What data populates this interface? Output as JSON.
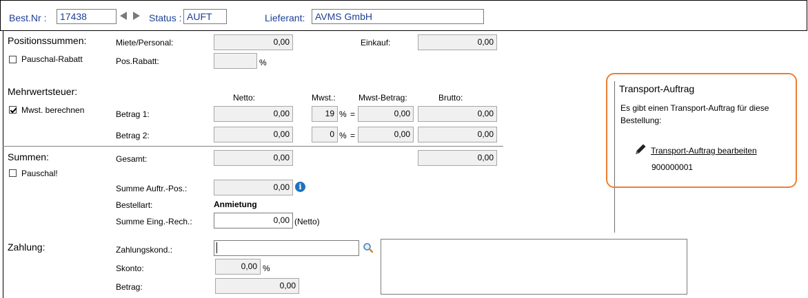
{
  "header": {
    "best_nr_label": "Best.Nr :",
    "best_nr_value": "17438",
    "status_label": "Status :",
    "status_value": "AUFT",
    "lieferant_label": "Lieferant:",
    "lieferant_value": "AVMS GmbH"
  },
  "positionssummen": {
    "title": "Positionssummen:",
    "pauschal_rabatt_label": "Pauschal-Rabatt",
    "pauschal_rabatt_checked": false,
    "miete_label": "Miete/Personal:",
    "miete_value": "0,00",
    "einkauf_label": "Einkauf:",
    "einkauf_value": "0,00",
    "posrabatt_label": "Pos.Rabatt:",
    "posrabatt_value": "",
    "percent": "%"
  },
  "mwst": {
    "title": "Mehrwertsteuer:",
    "berechnen_label": "Mwst. berechnen",
    "berechnen_checked": true,
    "col_netto": "Netto:",
    "col_mwst": "Mwst.:",
    "col_mwst_betrag": "Mwst-Betrag:",
    "col_brutto": "Brutto:",
    "percent": "%",
    "equals": "=",
    "rows": [
      {
        "label": "Betrag 1:",
        "netto": "0,00",
        "mwst": "19",
        "mwst_betrag": "0,00",
        "brutto": "0,00"
      },
      {
        "label": "Betrag 2:",
        "netto": "0,00",
        "mwst": "0",
        "mwst_betrag": "0,00",
        "brutto": "0,00"
      }
    ]
  },
  "summen": {
    "title": "Summen:",
    "pauschal_label": "Pauschal!",
    "pauschal_checked": false,
    "gesamt_label": "Gesamt:",
    "gesamt_netto": "0,00",
    "gesamt_brutto": "0,00",
    "summe_auftr_label": "Summe Auftr.-Pos.:",
    "summe_auftr_value": "0,00",
    "bestellart_label": "Bestellart:",
    "bestellart_value": "Anmietung",
    "summe_eing_label": "Summe Eing.-Rech.:",
    "summe_eing_value": "0,00",
    "netto_suffix": "(Netto)"
  },
  "zahlung": {
    "title": "Zahlung:",
    "kond_label": "Zahlungskond.:",
    "kond_value": "",
    "skonto_label": "Skonto:",
    "skonto_value": "0,00",
    "percent": "%",
    "betrag_label": "Betrag:",
    "betrag_value": "0,00",
    "notes_value": ""
  },
  "transport": {
    "title": "Transport-Auftrag",
    "message": "Es gibt einen Transport-Auftrag für diese Bestellung:",
    "edit_link": "Transport-Auftrag bearbeiten",
    "number": "900000001"
  },
  "colors": {
    "label_blue": "#1c3f95",
    "highlight_orange": "#ed7d31",
    "info_blue": "#1e73be"
  },
  "icons": [
    "arrow-left-icon",
    "arrow-right-icon",
    "info-icon",
    "search-icon",
    "pencil-icon"
  ]
}
